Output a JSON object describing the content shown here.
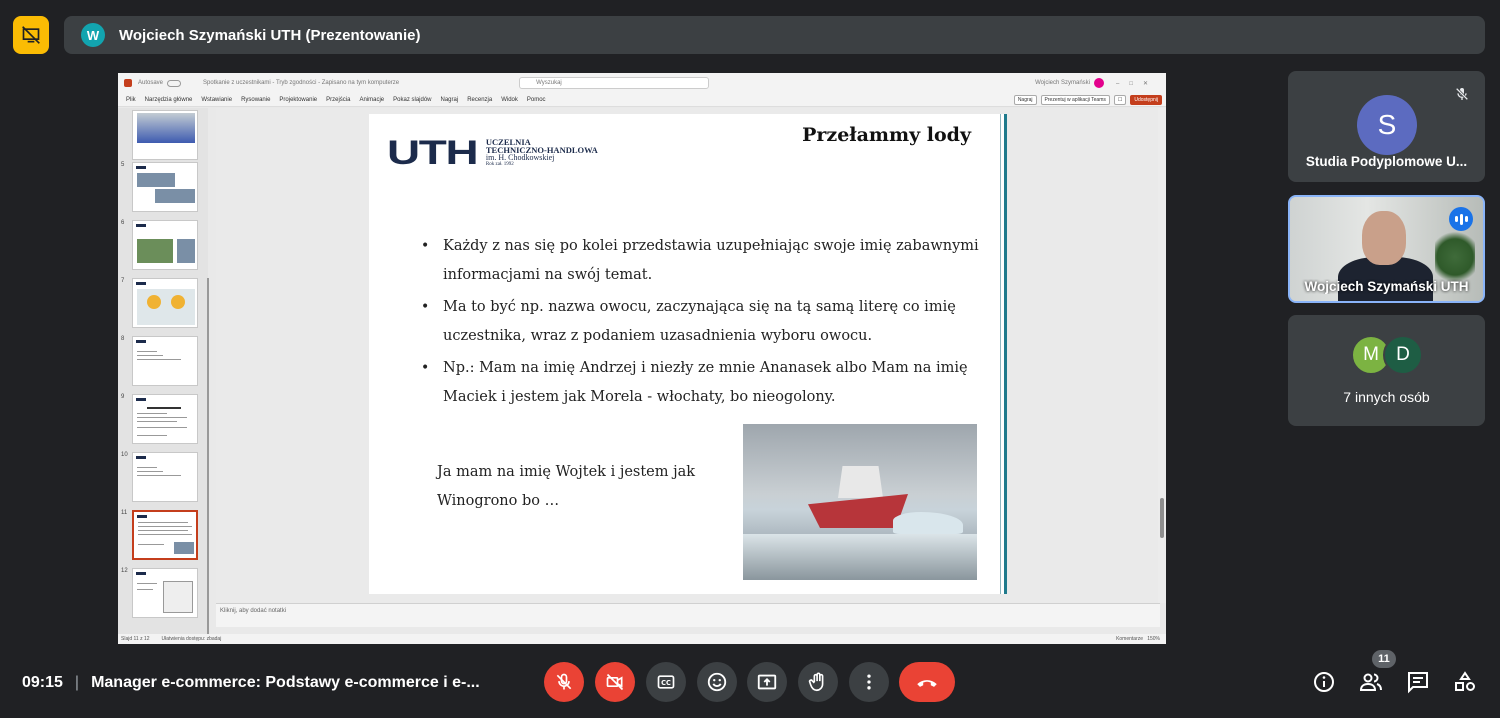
{
  "meeting": {
    "presenter_title": "Wojciech Szymański UTH (Prezentowanie)",
    "presenter_initial": "W",
    "time": "09:15",
    "meeting_name": "Manager e-commerce: Podstawy e-commerce i e-..."
  },
  "powerpoint": {
    "autosave": "Autosave",
    "file_name": "Spotkanie z uczestnikami - Tryb zgodności - Zapisano na tym komputerze",
    "search": "Wyszukaj",
    "user": "Wojciech Szymański",
    "menu": [
      "Plik",
      "Narzędzia główne",
      "Wstawianie",
      "Rysowanie",
      "Projektowanie",
      "Przejścia",
      "Animacje",
      "Pokaz slajdów",
      "Nagraj",
      "Recenzja",
      "Widok",
      "Pomoc"
    ],
    "buttons": [
      "Nagraj",
      "Prezentuj w aplikacji Teams",
      "Udostępnij"
    ],
    "notes_placeholder": "Kliknij, aby dodać notatki",
    "status_left": "Slajd 11 z 12",
    "status_accessibility": "Ułatwienia dostępu: zbadaj",
    "status_right": "Komentarze",
    "zoom": "150%",
    "thumbnail_numbers": [
      "5",
      "6",
      "7",
      "8",
      "9",
      "10",
      "11",
      "12"
    ]
  },
  "slide": {
    "title": "Przełammy lody",
    "logo_letters": "UTH",
    "logo_line1": "UCZELNIA",
    "logo_line2": "TECHNICZNO-HANDLOWA",
    "logo_line3": "im. H. Chodkowskiej",
    "logo_line4": "Rok zał. 1992",
    "bullets": [
      "Każdy z nas się po kolei przedstawia uzupełniając swoje imię zabawnymi informacjami na swój temat.",
      "Ma to być np. nazwa owocu, zaczynająca się na tą samą literę co imię uczestnika, wraz z podaniem uzasadnienia wyboru owocu.",
      "Np.: Mam na imię Andrzej i niezły ze mnie Ananasek albo Mam na imię Maciek i jestem jak Morela - włochaty, bo nieogolony."
    ],
    "answer": "Ja mam na imię Wojtek i jestem jak Winogrono bo …"
  },
  "participants": {
    "tile1_initial": "S",
    "tile1_name": "Studia Podyplomowe U...",
    "tile2_name": "Wojciech Szymański UTH",
    "tile3_initial_a": "M",
    "tile3_initial_b": "D",
    "tile3_label": "7 innych osób",
    "count_badge": "11"
  },
  "colors": {
    "background": "#202124",
    "surface": "#3c4043",
    "alert": "#fbbc04",
    "danger": "#ea4335",
    "active_border": "#8ab4f8",
    "slide_accent": "#1f7a8c"
  },
  "icons": [
    "present-stopped-icon",
    "mic-off-icon",
    "camera-off-icon",
    "captions-icon",
    "emoji-icon",
    "present-icon",
    "raise-hand-icon",
    "more-icon",
    "hangup-icon",
    "info-icon",
    "people-icon",
    "chat-icon",
    "activities-icon",
    "speaking-icon"
  ]
}
